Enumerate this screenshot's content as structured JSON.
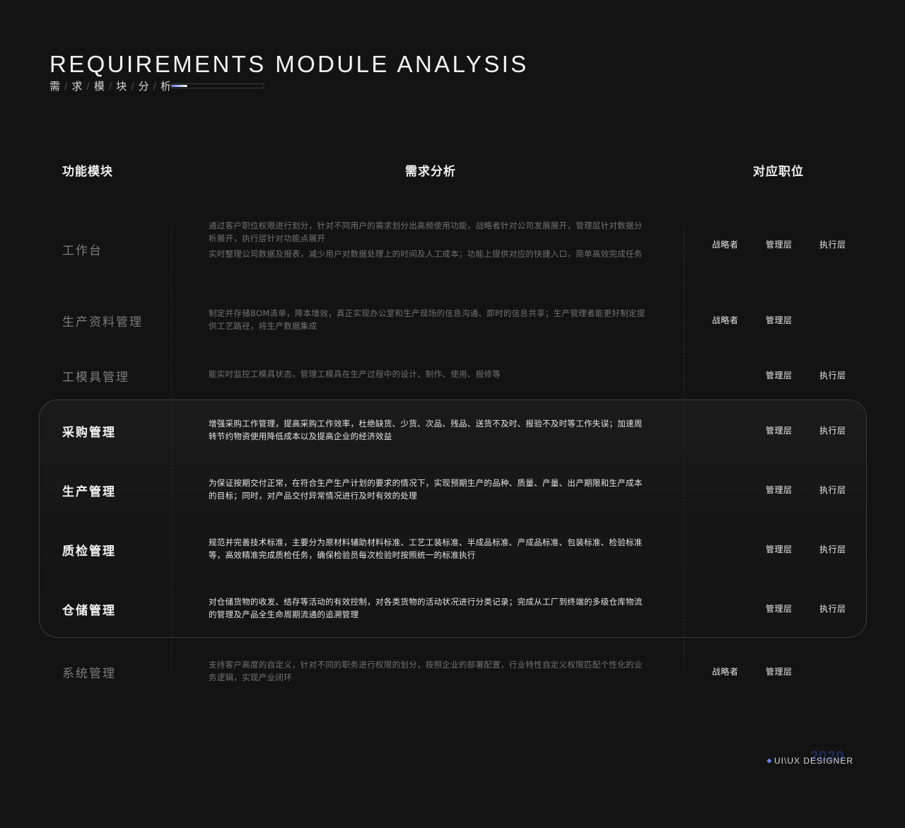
{
  "header": {
    "title_en": "REQUIREMENTS MODULE ANALYSIS",
    "title_cn_chars": [
      "需",
      "求",
      "模",
      "块",
      "分",
      "析"
    ],
    "progress_fraction": 0.18,
    "accent_color": "#6a80e8"
  },
  "columns": {
    "module": "功能模块",
    "analysis": "需求分析",
    "roles": "对应职位"
  },
  "rows": [
    {
      "module": "工作台",
      "desc": [
        "通过客户职位权限进行划分，针对不同用户的需求划分出高频使用功能，战略者针对公司发展展开，管理层针对数据分析展开，执行层针对功能点展开",
        "实时整理公司数据及报表，减少用户对数据处理上的时间及人工成本；功能上提供对应的快捷入口，简单高效完成任务"
      ],
      "roles": [
        "战略者",
        "管理层",
        "执行层"
      ]
    },
    {
      "module": "生产资料管理",
      "desc": [
        "制定并存储BOM清单，降本增效，真正实现办公室和生产现场的信息沟通、即时的信息共享；生产管理者能更好制定提供工艺路径，将生产数据集成"
      ],
      "roles": [
        "战略者",
        "管理层",
        ""
      ]
    },
    {
      "module": "工模具管理",
      "desc": [
        "能实时监控工模具状态，管理工模具在生产过程中的设计、制作、使用、报修等"
      ],
      "roles": [
        "",
        "管理层",
        "执行层"
      ]
    },
    {
      "module": "采购管理",
      "desc": [
        "增强采购工作管理，提高采购工作效率，杜绝缺货、少货、次品、残品、送货不及时、报验不及时等工作失误；加速周转节约物资使用降低成本以及提高企业的经济效益"
      ],
      "roles": [
        "",
        "管理层",
        "执行层"
      ]
    },
    {
      "module": "生产管理",
      "desc": [
        "为保证按期交付正常，在符合生产生产计划的要求的情况下，实现预期生产的品种、质量、产量、出产期限和生产成本的目标；同时，对产品交付异常情况进行及时有效的处理"
      ],
      "roles": [
        "",
        "管理层",
        "执行层"
      ]
    },
    {
      "module": "质检管理",
      "desc": [
        "规范并完善技术标准，主要分为原材料辅助材料标准、工艺工装标准、半成品标准、产成品标准、包装标准、检验标准等，高效精准完成质检任务，确保检验员每次检验时按照统一的标准执行"
      ],
      "roles": [
        "",
        "管理层",
        "执行层"
      ]
    },
    {
      "module": "仓储管理",
      "desc": [
        "对仓储货物的收发、结存等活动的有效控制，对各类货物的活动状况进行分类记录；完成从工厂到终端的多级仓库物流的管理及产品全生命周期流通的追溯管理"
      ],
      "roles": [
        "",
        "管理层",
        "执行层"
      ]
    },
    {
      "module": "系统管理",
      "desc": [
        "支持客户高度的自定义，针对不同的职务进行权限的划分，按照企业的部署配置，行业特性自定义权限匹配个性化的业务逻辑，实现产业闭环"
      ],
      "roles": [
        "战略者",
        "管理层",
        ""
      ]
    }
  ],
  "footer": {
    "label": "UI\\UX DESIGNER",
    "year": "2020"
  }
}
